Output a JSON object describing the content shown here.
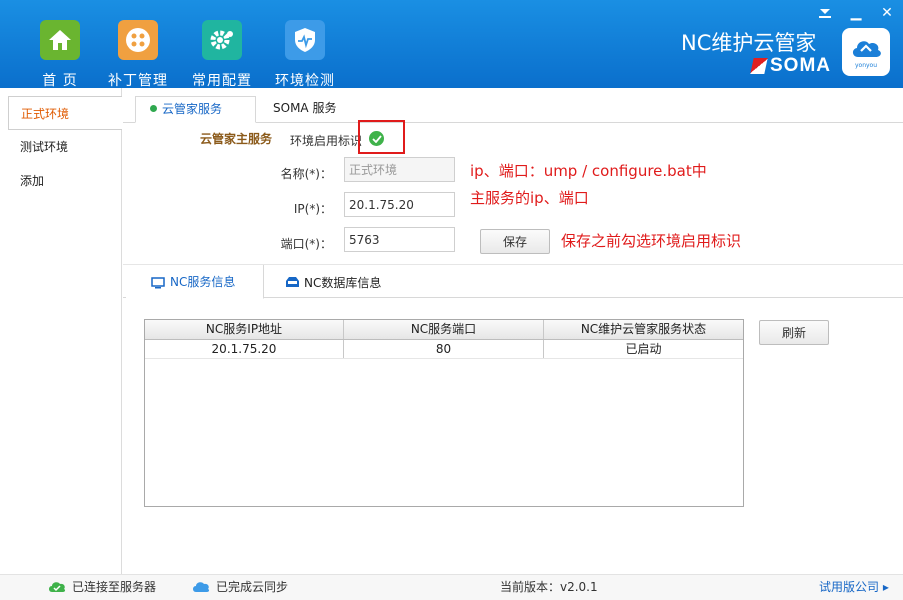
{
  "nav": [
    {
      "label": "首 页",
      "icon": "home-icon",
      "color": "#6ab530"
    },
    {
      "label": "补丁管理",
      "icon": "patch-icon",
      "color": "#f0a040"
    },
    {
      "label": "常用配置",
      "icon": "gear-icon",
      "color": "#20b5a0"
    },
    {
      "label": "环境检测",
      "icon": "shield-icon",
      "color": "#3d9be8"
    }
  ],
  "brand": {
    "title": "NC维护云管家",
    "logo_text": "SOMA",
    "badge_text": "yonyou"
  },
  "window": {
    "minimize_glyph": "▁",
    "close_glyph": "✕"
  },
  "sidebar": {
    "items": [
      {
        "label": "正式环境",
        "active": true
      },
      {
        "label": "测试环境",
        "active": false
      },
      {
        "label": "添加",
        "active": false
      }
    ]
  },
  "tabs": [
    {
      "label": "云管家服务",
      "active": true
    },
    {
      "label": "SOMA 服务",
      "active": false
    }
  ],
  "form": {
    "section_title": "云管家主服务",
    "enabled_label": "环境启用标识",
    "enabled": true,
    "name_label": "名称(*)：",
    "name_value": "正式环境",
    "ip_label": "IP(*)：",
    "ip_value": "20.1.75.20",
    "port_label": "端口(*)：",
    "port_value": "5763",
    "save_label": "保存"
  },
  "annotations": {
    "line1": "ip、端口：ump / configure.bat中",
    "line2": "主服务的ip、端口",
    "line3": "保存之前勾选环境启用标识",
    "color": "#e01b1b"
  },
  "subtabs": [
    {
      "label": "NC服务信息",
      "active": true
    },
    {
      "label": "NC数据库信息",
      "active": false
    }
  ],
  "table": {
    "columns": [
      "NC服务IP地址",
      "NC服务端口",
      "NC维护云管家服务状态"
    ],
    "rows": [
      [
        "20.1.75.20",
        "80",
        "已启动"
      ]
    ]
  },
  "refresh_label": "刷新",
  "status": {
    "connected": "已连接至服务器",
    "synced": "已完成云同步",
    "version": "当前版本：v2.0.1",
    "company": "试用版公司 ▸"
  }
}
